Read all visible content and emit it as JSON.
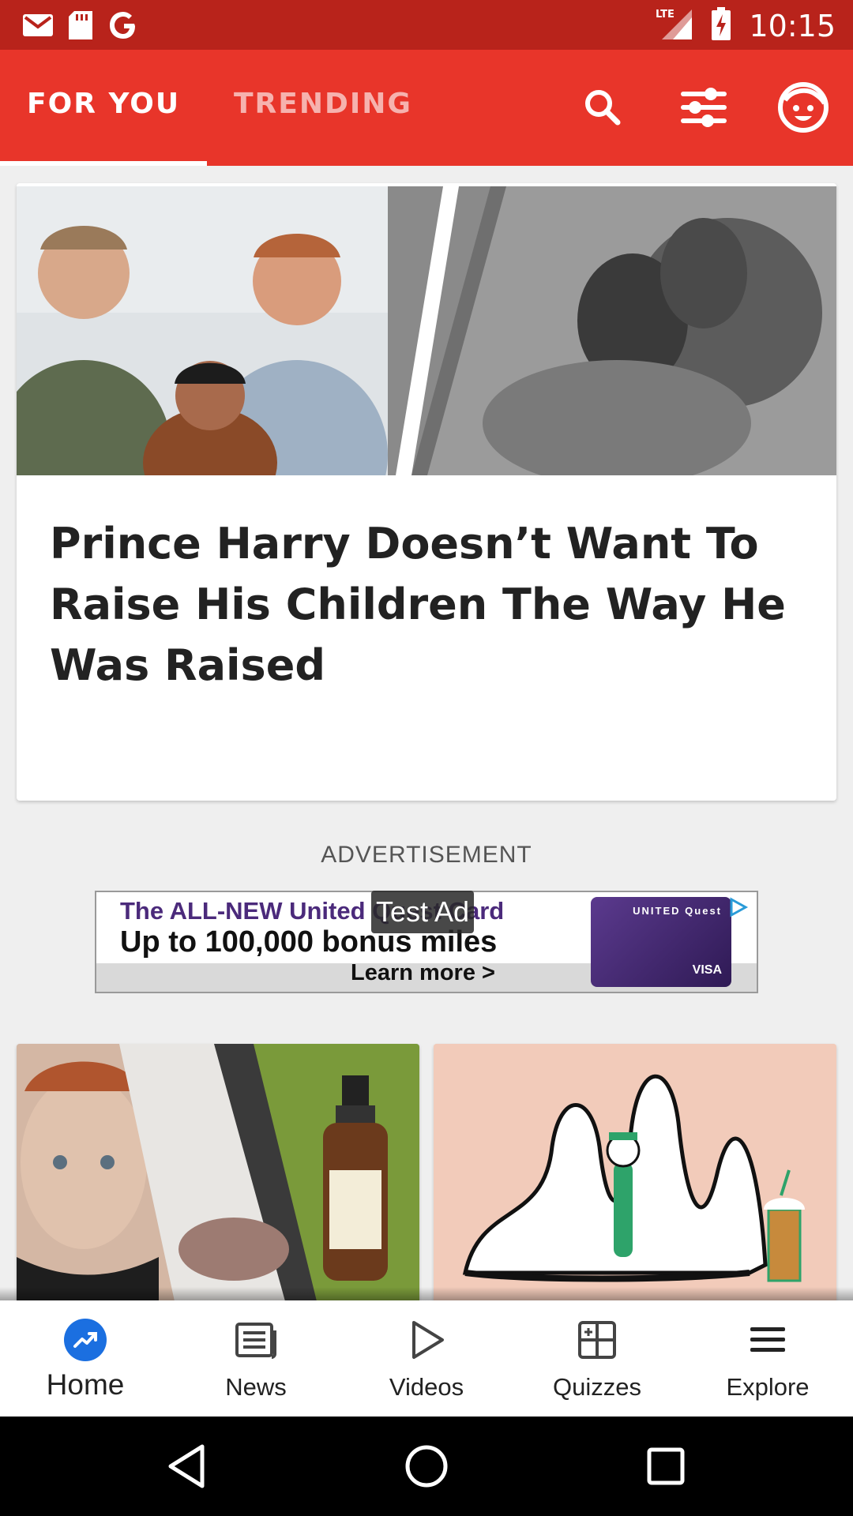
{
  "status_bar": {
    "time": "10:15",
    "network": "LTE",
    "icons": [
      "gmail-icon",
      "sd-card-icon",
      "google-icon",
      "signal-icon",
      "battery-icon"
    ]
  },
  "top_bar": {
    "tabs": [
      {
        "label": "FOR YOU",
        "active": true
      },
      {
        "label": "TRENDING",
        "active": false
      }
    ],
    "icons": [
      "search-icon",
      "filter-icon",
      "profile-icon"
    ]
  },
  "feed": {
    "hero": {
      "title": "Prince Harry Doesn’t Want To Raise His Children The Way He Was Raised",
      "image": "hero-photo"
    },
    "ad": {
      "label": "ADVERTISEMENT",
      "overlay": "Test Ad",
      "line1": "The ALL-NEW United Quest Card",
      "line2": "Up to 100,000 bonus miles",
      "line3": "Learn more >",
      "card_brand": "UNITED Quest",
      "card_network": "VISA"
    },
    "thumbnails": [
      "spray-photo",
      "receipt-illustration"
    ]
  },
  "bottom_nav": {
    "items": [
      {
        "label": "Home",
        "icon": "trending-icon",
        "active": true
      },
      {
        "label": "News",
        "icon": "news-icon",
        "active": false
      },
      {
        "label": "Videos",
        "icon": "play-icon",
        "active": false
      },
      {
        "label": "Quizzes",
        "icon": "quiz-grid-icon",
        "active": false
      },
      {
        "label": "Explore",
        "icon": "menu-icon",
        "active": false
      }
    ]
  },
  "system_nav": {
    "icons": [
      "back-icon",
      "home-circle-icon",
      "recents-icon"
    ]
  },
  "colors": {
    "brand_red": "#e8352a",
    "status_red": "#b8231b",
    "accent_blue": "#1b6fe0"
  }
}
